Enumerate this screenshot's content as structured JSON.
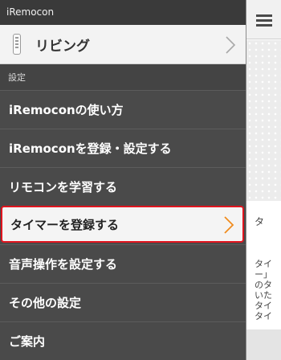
{
  "drawer": {
    "title": "iRemocon",
    "room": {
      "label": "リビング"
    },
    "section_header": "設定",
    "items": [
      {
        "label": "iRemoconの使い方"
      },
      {
        "label": "iRemoconを登録・設定する"
      },
      {
        "label": "リモコンを学習する"
      },
      {
        "label": "タイマーを登録する",
        "selected": true
      },
      {
        "label": "音声操作を設定する"
      },
      {
        "label": "その他の設定"
      },
      {
        "label": "ご案内"
      }
    ]
  },
  "main": {
    "menu_icon": "hamburger-icon",
    "peek_title": "タ",
    "peek_lines": [
      "タイ",
      "ー」",
      "のタ",
      "いた",
      "タイ",
      "タイ"
    ]
  },
  "colors": {
    "selected_border": "#e0141e",
    "chevron_selected": "#f08c1e",
    "drawer_bg": "#4a4a4a"
  }
}
